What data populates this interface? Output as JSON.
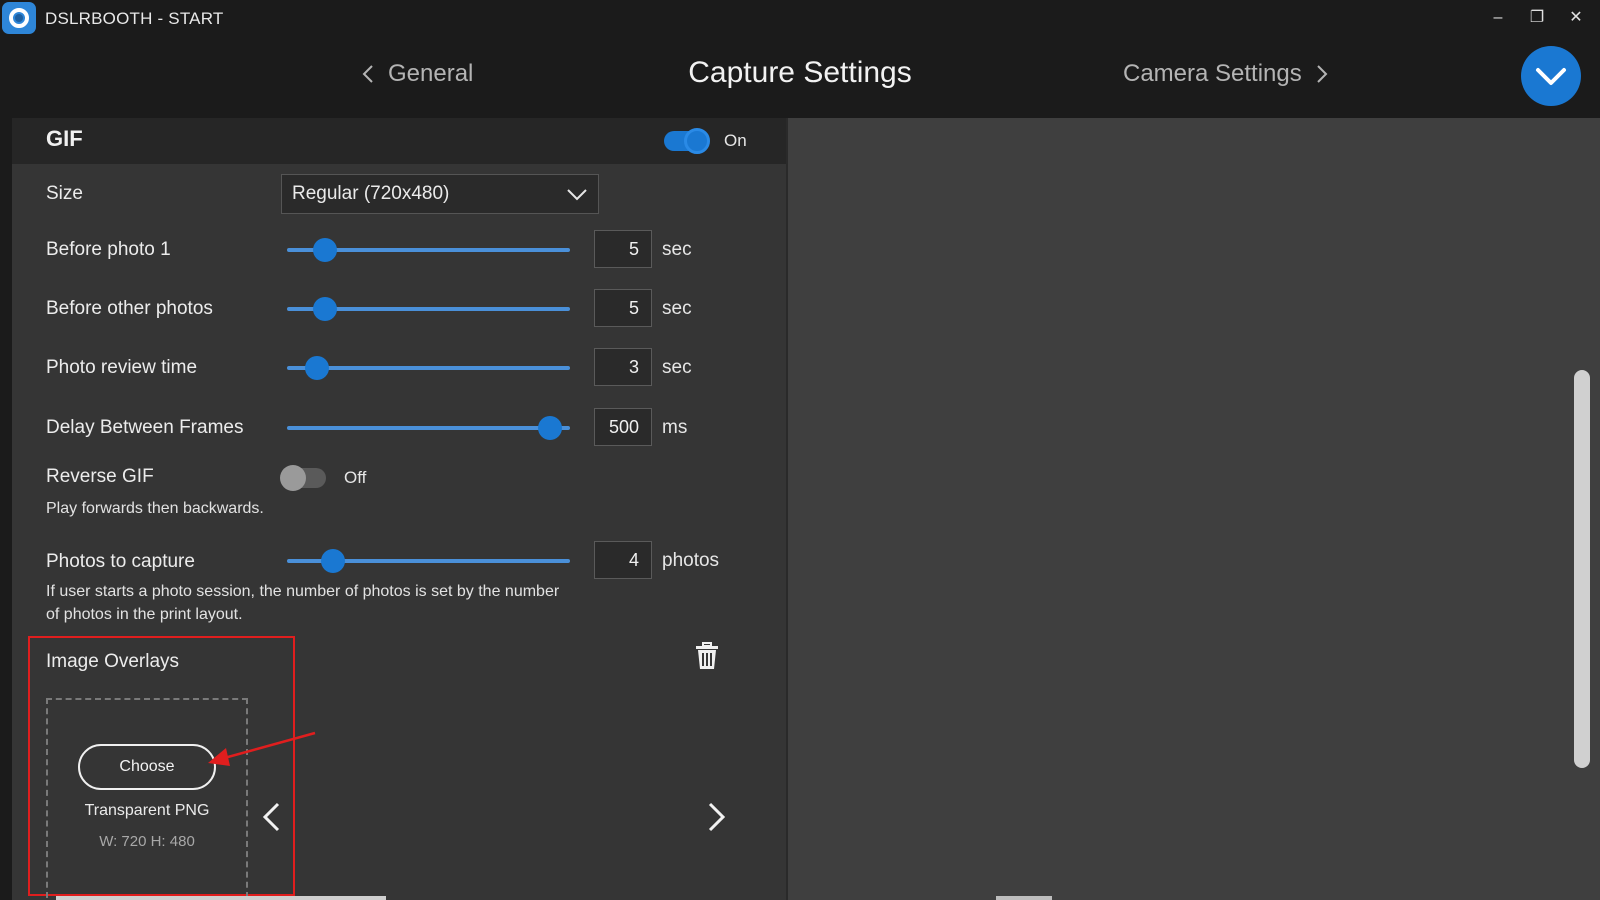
{
  "window": {
    "title": "DSLRBOOTH - START",
    "minimize_glyph": "‒",
    "restore_glyph": "❐",
    "close_glyph": "✕"
  },
  "header": {
    "prev_label": "General",
    "title": "Capture Settings",
    "next_label": "Camera Settings",
    "accent_color": "#1a78d2"
  },
  "gif": {
    "title": "GIF",
    "enabled_label": "On",
    "size_label": "Size",
    "size_value": "Regular (720x480)",
    "before_photo_1": {
      "label": "Before photo 1",
      "value": "5",
      "unit": "sec",
      "level": 0.1
    },
    "before_other_photos": {
      "label": "Before other photos",
      "value": "5",
      "unit": "sec",
      "level": 0.1
    },
    "photo_review_time": {
      "label": "Photo review time",
      "value": "3",
      "unit": "sec",
      "level": 0.07
    },
    "delay_between_frames": {
      "label": "Delay Between Frames",
      "value": "500",
      "unit": "ms",
      "level": 0.97
    },
    "reverse_gif": {
      "label": "Reverse GIF",
      "state_label": "Off",
      "hint": "Play forwards then backwards."
    },
    "photos_to_capture": {
      "label": "Photos to capture",
      "value": "4",
      "unit": "photos",
      "level": 0.13,
      "hint": "If user starts a photo session, the number of photos is set by the number of photos in the print layout."
    },
    "image_overlays": {
      "label": "Image Overlays",
      "choose_label": "Choose",
      "type_label": "Transparent PNG",
      "dimensions_label": "W: 720 H: 480"
    }
  }
}
